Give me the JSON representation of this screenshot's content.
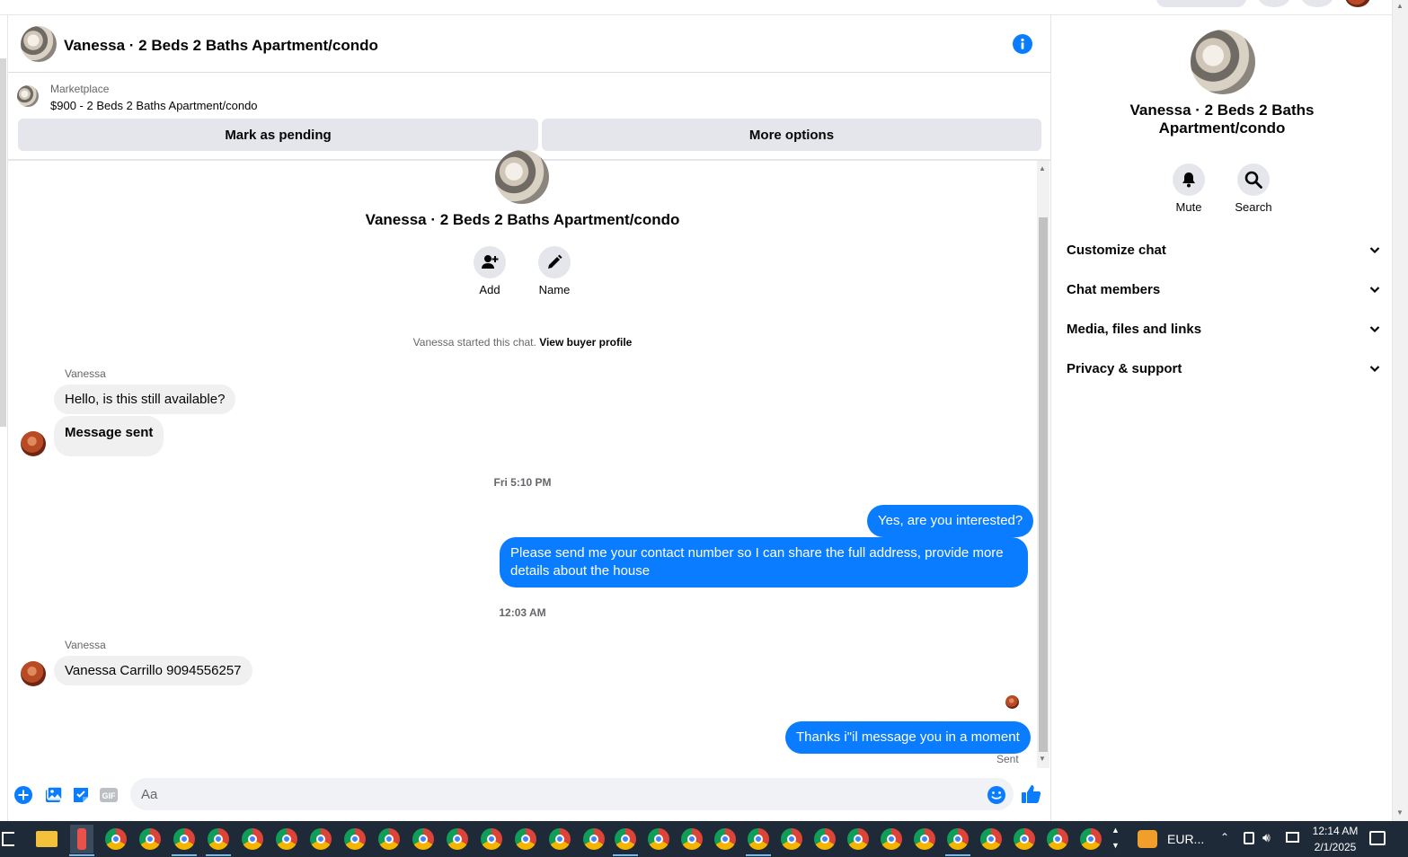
{
  "header": {
    "title": "Vanessa · 2 Beds 2 Baths Apartment/condo"
  },
  "marketplace": {
    "label": "Marketplace",
    "listing": "$900 - 2 Beds 2 Baths Apartment/condo"
  },
  "actions": {
    "pending": "Mark as pending",
    "more": "More options"
  },
  "conversation": {
    "title": "Vanessa · 2 Beds 2 Baths Apartment/condo",
    "add_label": "Add",
    "name_label": "Name",
    "started_text": "Vanessa started this chat.",
    "view_profile": "View buyer profile"
  },
  "messages": {
    "sender1": "Vanessa",
    "m1": "Hello, is this still available?",
    "m2": "Message sent",
    "time1": "Fri 5:10 PM",
    "m3": "Yes, are you interested?",
    "m4": "Please send me your contact number so I can share the full address, provide more details about the house",
    "time2": "12:03 AM",
    "sender2": "Vanessa",
    "m5": "Vanessa Carrillo 9094556257",
    "m6": "Thanks i\"il message you in a moment",
    "status": "Sent"
  },
  "composer": {
    "placeholder": "Aa",
    "gif_label": "GIF"
  },
  "right_panel": {
    "title": "Vanessa · 2 Beds 2 Baths Apartment/condo",
    "mute_label": "Mute",
    "search_label": "Search",
    "sections": [
      "Customize chat",
      "Chat members",
      "Media, files and links",
      "Privacy & support"
    ]
  },
  "taskbar": {
    "tray_label": "EUR...",
    "time": "12:14 AM",
    "date": "2/1/2025"
  },
  "colors": {
    "accent": "#0a7cff",
    "bubble_in": "#f0f0f0",
    "button_bg": "#e4e6eb",
    "taskbar": "#1f2a38"
  },
  "icons": [
    "info-icon",
    "add-person-icon",
    "pencil-icon",
    "plus-icon",
    "image-icon",
    "sticker-icon",
    "gif-icon",
    "emoji-icon",
    "thumbs-up-icon",
    "bell-icon",
    "search-icon",
    "chevron-down-icon"
  ]
}
